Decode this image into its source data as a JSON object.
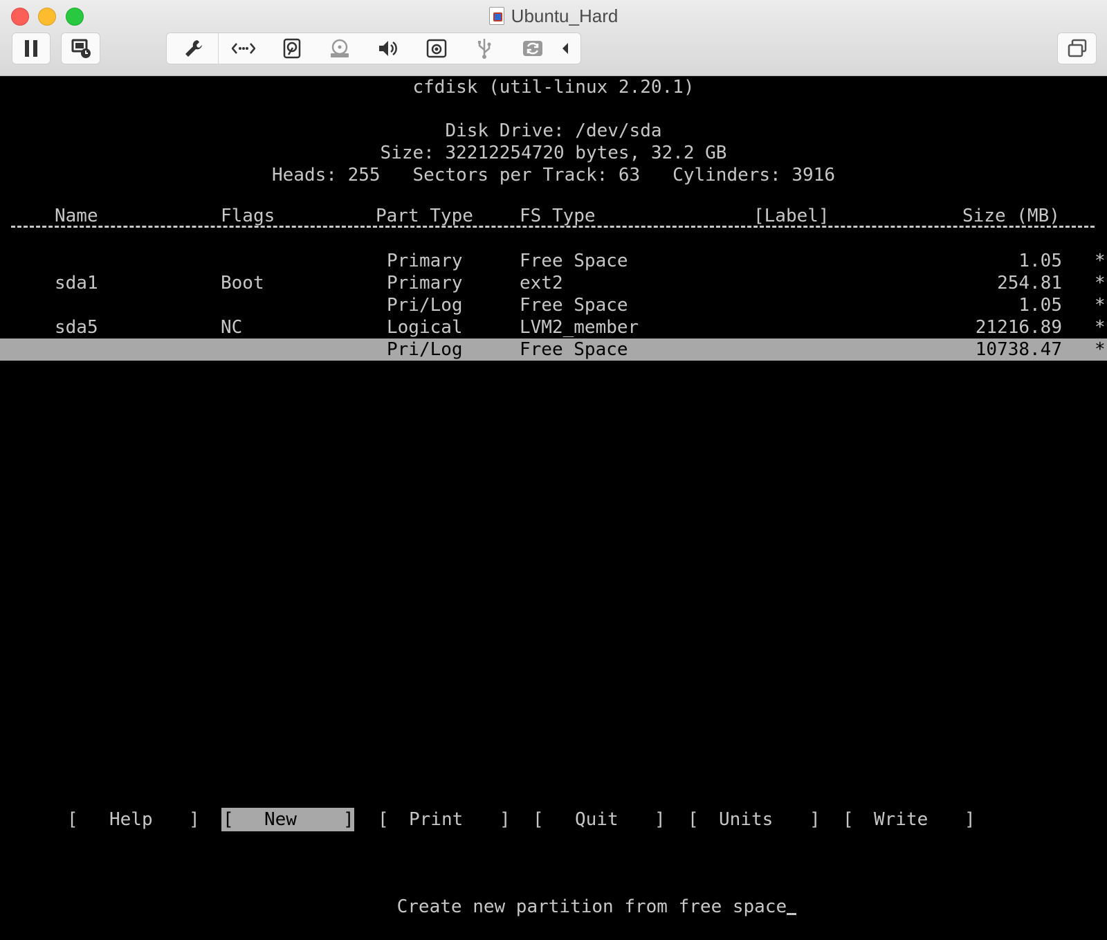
{
  "window": {
    "title": "Ubuntu_Hard"
  },
  "toolbar": {
    "left_buttons": [
      "pause-icon",
      "snapshot-icon"
    ],
    "group_icons": [
      "wrench-icon",
      "network-icon",
      "hard-disk-icon",
      "cd-dvd-icon",
      "sound-icon",
      "camera-icon",
      "usb-icon",
      "sharing-icon",
      "collapse-arrow-icon"
    ],
    "right_buttons": [
      "window-icon"
    ]
  },
  "terminal": {
    "program": "cfdisk (util-linux 2.20.1)",
    "disk_drive": "Disk Drive: /dev/sda",
    "size_line": "Size: 32212254720 bytes, 32.2 GB",
    "geometry_line": "Heads: 255   Sectors per Track: 63   Cylinders: 3916",
    "columns": {
      "name": "Name",
      "flags": "Flags",
      "part_type": "Part Type",
      "fs_type": "FS Type",
      "label": "[Label]",
      "size": "Size (MB)"
    },
    "partitions": [
      {
        "name": "",
        "flags": "",
        "part_type": "Primary",
        "fs_type": "Free Space",
        "size": "1.05",
        "marker": "*"
      },
      {
        "name": "sda1",
        "flags": "Boot",
        "part_type": "Primary",
        "fs_type": "ext2",
        "size": "254.81",
        "marker": "*"
      },
      {
        "name": "",
        "flags": "",
        "part_type": "Pri/Log",
        "fs_type": "Free Space",
        "size": "1.05",
        "marker": "*"
      },
      {
        "name": "sda5",
        "flags": "NC",
        "part_type": "Logical",
        "fs_type": "LVM2_member",
        "size": "21216.89",
        "marker": "*"
      },
      {
        "name": "",
        "flags": "",
        "part_type": "Pri/Log",
        "fs_type": "Free Space",
        "size": "10738.47",
        "marker": "*"
      }
    ],
    "menu": [
      {
        "label": "Help",
        "selected": false
      },
      {
        "label": "New",
        "selected": true
      },
      {
        "label": "Print",
        "selected": false
      },
      {
        "label": "Quit",
        "selected": false
      },
      {
        "label": "Units",
        "selected": false
      },
      {
        "label": "Write",
        "selected": false
      }
    ],
    "menu_brackets": {
      "open": "[",
      "close": "]"
    },
    "status": "Create new partition from free space"
  }
}
